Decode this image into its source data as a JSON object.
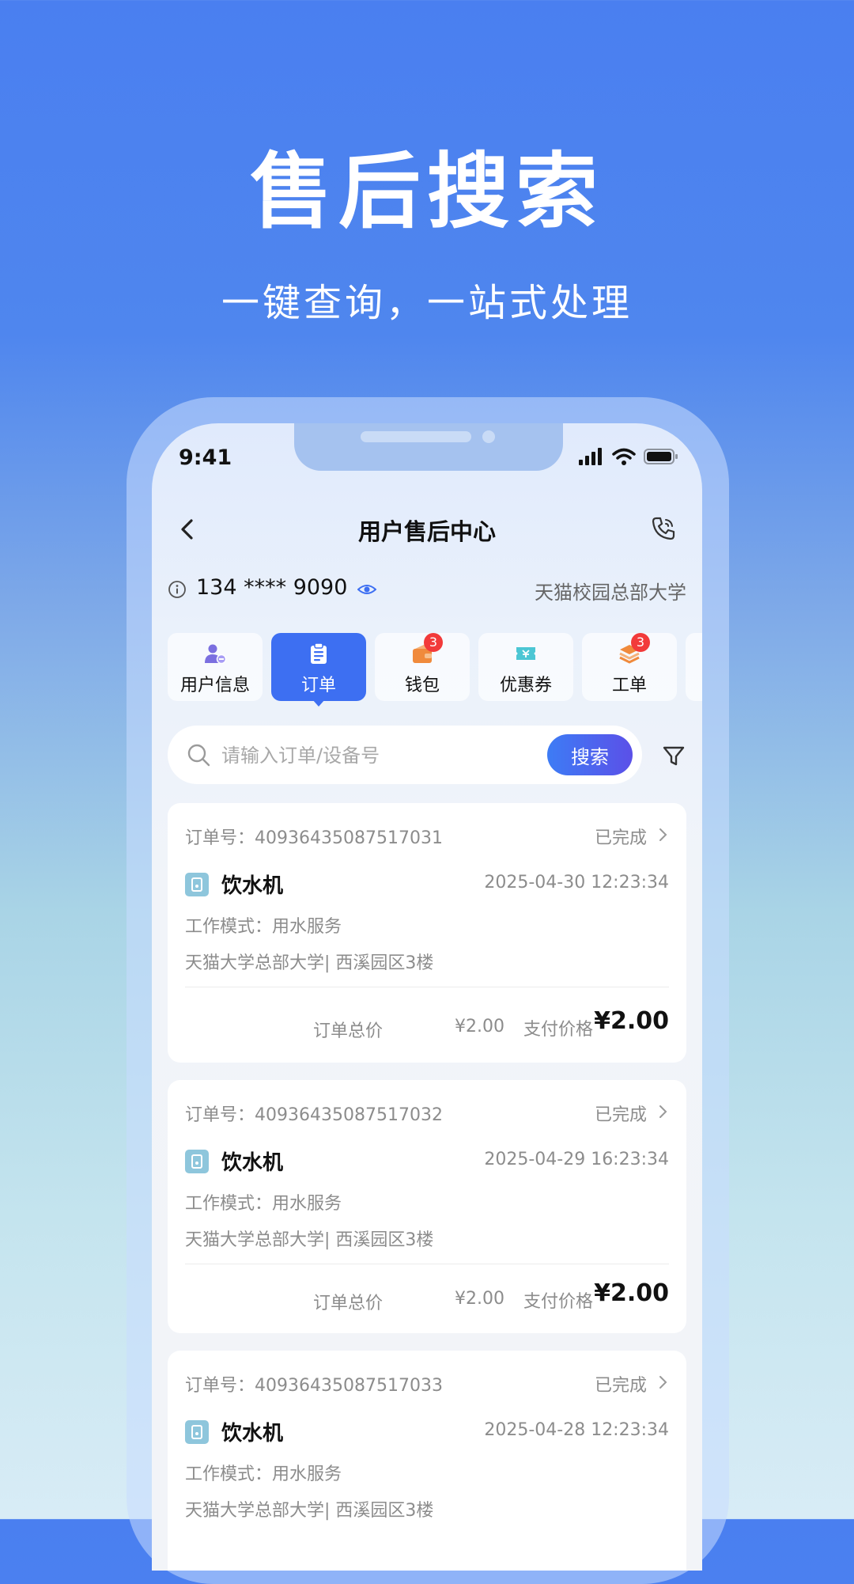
{
  "hero": {
    "title": "售后搜索",
    "subtitle": "一键查询，一站式处理"
  },
  "status_bar": {
    "time": "9:41"
  },
  "nav": {
    "title": "用户售后中心"
  },
  "user": {
    "phone": "134 **** 9090",
    "school": "天猫校园总部大学"
  },
  "tabs": [
    {
      "label": "用户信息",
      "icon": "user-info-icon",
      "color": "#7b6fe0"
    },
    {
      "label": "订单",
      "icon": "order-clipboard-icon",
      "active": true
    },
    {
      "label": "钱包",
      "icon": "wallet-icon",
      "badge": "3",
      "color": "#f08a3c"
    },
    {
      "label": "优惠券",
      "icon": "coupon-icon",
      "color": "#4cc6d4"
    },
    {
      "label": "工单",
      "icon": "ticket-stack-icon",
      "badge": "3",
      "color": "#f08a3c"
    }
  ],
  "search": {
    "placeholder": "请输入订单/设备号",
    "button": "搜索"
  },
  "orders": [
    {
      "no_label": "订单号：",
      "no": "40936435087517031",
      "status": "已完成",
      "device": "饮水机",
      "time": "2025-04-30 12:23:34",
      "mode": "工作模式：用水服务",
      "location": "天猫大学总部大学| 西溪园区3楼",
      "total_label": "订单总价",
      "total": "¥2.00",
      "pay_label": "支付价格",
      "pay": "¥2.00"
    },
    {
      "no_label": "订单号：",
      "no": "40936435087517032",
      "status": "已完成",
      "device": "饮水机",
      "time": "2025-04-29 16:23:34",
      "mode": "工作模式：用水服务",
      "location": "天猫大学总部大学| 西溪园区3楼",
      "total_label": "订单总价",
      "total": "¥2.00",
      "pay_label": "支付价格",
      "pay": "¥2.00"
    },
    {
      "no_label": "订单号：",
      "no": "40936435087517033",
      "status": "已完成",
      "device": "饮水机",
      "time": "2025-04-28 12:23:34",
      "mode": "工作模式：用水服务",
      "location": "天猫大学总部大学| 西溪园区3楼"
    }
  ],
  "colors": {
    "accent": "#3d6ff2",
    "badge": "#f23a3a",
    "device_icon": "#8ec6dc"
  }
}
